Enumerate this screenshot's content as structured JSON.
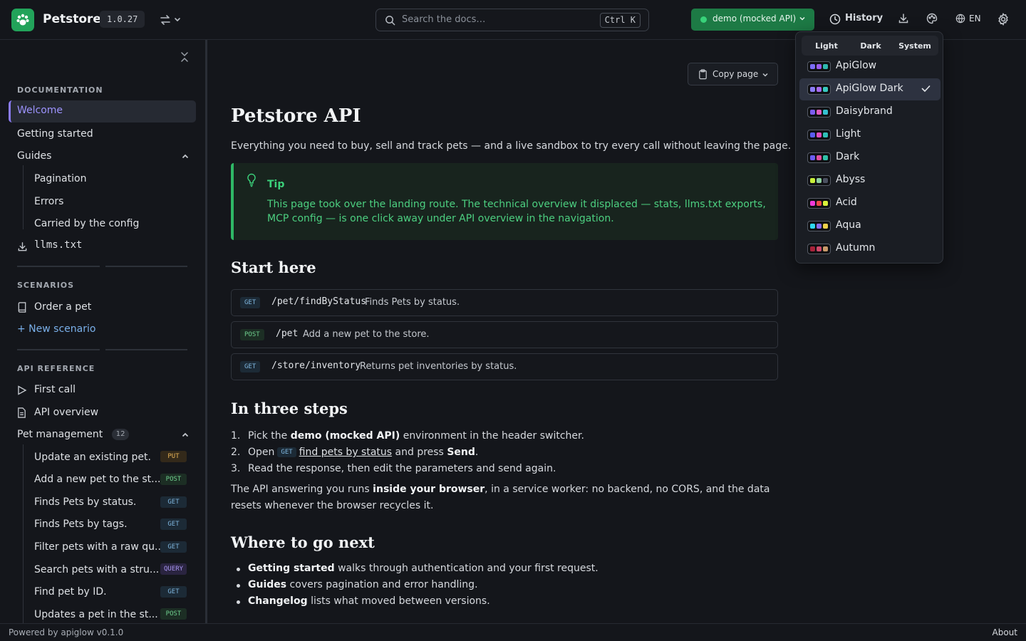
{
  "header": {
    "brand": "Petstore",
    "version": "1.0.27",
    "search_placeholder": "Search the docs…",
    "search_shortcut": "Ctrl K",
    "environment": "demo (mocked API)",
    "history_label": "History",
    "language": "EN",
    "accent_color": "#22a35a"
  },
  "sidebar": {
    "sections": {
      "documentation": "DOCUMENTATION",
      "scenarios": "SCENARIOS",
      "api_reference": "API REFERENCE"
    },
    "documentation": {
      "welcome": "Welcome",
      "getting_started": "Getting started",
      "guides": "Guides",
      "guide_items": [
        "Pagination",
        "Errors",
        "Carried by the config"
      ],
      "llms": "llms.txt"
    },
    "scenarios": {
      "order": "Order a pet",
      "new": "+ New scenario"
    },
    "api_reference": {
      "first_call": "First call",
      "overview": "API overview",
      "group": "Pet management",
      "group_count": "12",
      "operations": [
        {
          "label": "Update an existing pet.",
          "method": "PUT"
        },
        {
          "label": "Add a new pet to the st...",
          "method": "POST"
        },
        {
          "label": "Finds Pets by status.",
          "method": "GET"
        },
        {
          "label": "Finds Pets by tags.",
          "method": "GET"
        },
        {
          "label": "Filter pets with a raw qu...",
          "method": "GET"
        },
        {
          "label": "Search pets with a stru...",
          "method": "QUERY"
        },
        {
          "label": "Find pet by ID.",
          "method": "GET"
        },
        {
          "label": "Updates a pet in the st...",
          "method": "POST"
        }
      ]
    }
  },
  "main": {
    "copy_page": "Copy page",
    "title": "Petstore API",
    "lead": "Everything you need to buy, sell and track pets — and a live sandbox to try every call without leaving the page.",
    "tip": {
      "title": "Tip",
      "body": "This page took over the landing route. The technical overview it displaced — stats, llms.txt exports, MCP config — is one click away under API overview in the navigation."
    },
    "start_here": "Start here",
    "endpoints": [
      {
        "method": "GET",
        "path": "/pet/findByStatus",
        "desc": "Finds Pets by status."
      },
      {
        "method": "POST",
        "path": "/pet",
        "desc": "Add a new pet to the store."
      },
      {
        "method": "GET",
        "path": "/store/inventory",
        "desc": "Returns pet inventories by status."
      }
    ],
    "three_steps": "In three steps",
    "steps": {
      "s1_pre": "Pick the ",
      "s1_bold": "demo (mocked API)",
      "s1_post": " environment in the header switcher.",
      "s2_pre": "Open",
      "s2_method": "GET",
      "s2_link": "find pets by status",
      "s2_mid": " and press ",
      "s2_bold": "Send",
      "s2_post": ".",
      "s3": "Read the response, then edit the parameters and send again."
    },
    "para": {
      "pre": "The API answering you runs ",
      "bold": "inside your browser",
      "post": ", in a service worker: no backend, no CORS, and the data resets whenever the browser recycles it."
    },
    "where_next": "Where to go next",
    "next_items": [
      {
        "bold": "Getting started",
        "text": " walks through authentication and your first request."
      },
      {
        "bold": "Guides",
        "text": " covers pagination and error handling."
      },
      {
        "bold": "Changelog",
        "text": " lists what moved between versions."
      }
    ]
  },
  "theme_menu": {
    "modes": [
      "Light",
      "Dark",
      "System"
    ],
    "selected": "ApiGlow Dark",
    "themes": [
      {
        "name": "ApiGlow",
        "colors": [
          "#7b6cf6",
          "#9a5cf0",
          "#2fb8b0"
        ]
      },
      {
        "name": "ApiGlow Dark",
        "colors": [
          "#8b7cf6",
          "#a86cf0",
          "#38c9bf"
        ]
      },
      {
        "name": "Daisybrand",
        "colors": [
          "#7c5cf0",
          "#e05cc0",
          "#35c0d0"
        ]
      },
      {
        "name": "Light",
        "colors": [
          "#5b5cf0",
          "#e04fc0",
          "#2fc0b8"
        ]
      },
      {
        "name": "Dark",
        "colors": [
          "#6b5cf0",
          "#e04fa0",
          "#2fc0a8"
        ]
      },
      {
        "name": "Abyss",
        "colors": [
          "#c8f03a",
          "#8fd0a0",
          "#4a5060"
        ]
      },
      {
        "name": "Acid",
        "colors": [
          "#f03ad8",
          "#f04a4a",
          "#d8f03a"
        ]
      },
      {
        "name": "Aqua",
        "colors": [
          "#2fd8f0",
          "#8a6cf0",
          "#f0d04a"
        ]
      },
      {
        "name": "Autumn",
        "colors": [
          "#a8223a",
          "#d04a6a",
          "#c89a6a"
        ]
      }
    ]
  },
  "footer": {
    "powered": "Powered by apiglow v0.1.0",
    "about": "About"
  }
}
